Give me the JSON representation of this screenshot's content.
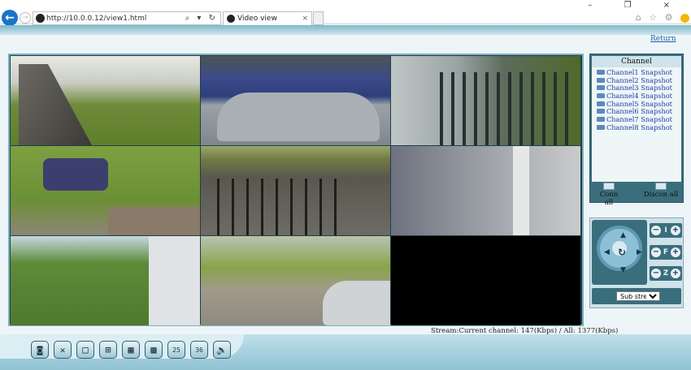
{
  "browser": {
    "url": "http://10.0.0.12/view1.html",
    "tab_title": "Video view",
    "back_icon": "←",
    "forward_icon": "→",
    "address_icons": "⌕ ▾ ↻",
    "tab_close": "×",
    "window_controls": "– ❐ ×",
    "toolbar_icons": "⌂ ☆ ⚙"
  },
  "page": {
    "return_label": "Return",
    "stream_info": "Stream:Current channel: 147(Kbps) / All: 1377(Kbps)"
  },
  "channel_panel": {
    "title": "Channel",
    "channels": [
      "Channel1 Snapshot",
      "Channel2 Snapshot",
      "Channel3 Snapshot",
      "Channel4 Snapshot",
      "Channel5 Snapshot",
      "Channel6 Snapshot",
      "Channel7 Snapshot",
      "Channel8 Snapshot"
    ],
    "conn_all_label": "Conn all",
    "disconn_all_label": "Discon all"
  },
  "ptz": {
    "up": "▲",
    "down": "▼",
    "left": "◀",
    "right": "▶",
    "center": "↻",
    "iris_label": "I",
    "focus_label": "F",
    "zoom_label": "Z",
    "minus": "−",
    "plus": "+",
    "stream_select": "Sub stream",
    "stream_options": [
      "Sub stream"
    ]
  },
  "toolbar": {
    "buttons": [
      {
        "name": "record-button",
        "glyph": "◙"
      },
      {
        "name": "settings-button",
        "glyph": "✕"
      },
      {
        "name": "layout-1-button",
        "glyph": "□"
      },
      {
        "name": "layout-4-button",
        "glyph": "⊞"
      },
      {
        "name": "layout-9-button",
        "glyph": "▦"
      },
      {
        "name": "layout-16-button",
        "glyph": "▩"
      },
      {
        "name": "layout-25-button",
        "glyph": "25"
      },
      {
        "name": "layout-36-button",
        "glyph": "36"
      },
      {
        "name": "audio-button",
        "glyph": "🔈"
      }
    ]
  }
}
